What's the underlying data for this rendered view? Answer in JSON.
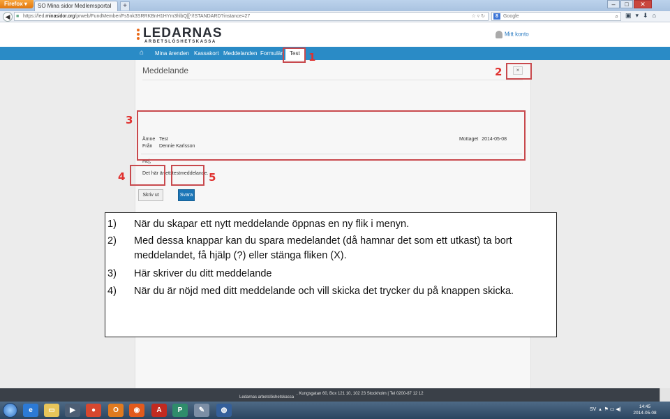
{
  "browser": {
    "firefox_label": "Firefox",
    "tab_title": "SO Mina sidor Medlemsportal",
    "new_tab": "+",
    "url_prefix": "https://led.",
    "url_domain": "minasidor.org",
    "url_path": "/prweb/FundMember/Fs5nk3SRRKBnH1HYm3hlbQ[[*/!STANDARD?instance=27",
    "search_placeholder": "Google",
    "search_engine_icon": "google-icon",
    "window_controls": [
      "–",
      "□",
      "✕"
    ]
  },
  "site": {
    "logo_main": "LEDARNAS",
    "logo_sub": "ARBETSLÖSHETSKASSA",
    "account_link": "Mitt konto",
    "menu": {
      "home_icon": "home-icon",
      "items": [
        "Mina ärenden",
        "Kassakort",
        "Meddelanden",
        "Formulär",
        "Test"
      ]
    }
  },
  "message_panel": {
    "title": "Meddelande",
    "close_label": "×",
    "subject_label": "Ämne",
    "subject_value": "Test",
    "from_label": "Från",
    "from_value": "Dennie Karlsson",
    "received_label": "Mottaget",
    "received_value": "2014-05-08",
    "body_line1": "Hej,",
    "body_line2": "Det här är ett testmeddelande.",
    "print_button": "Skriv ut",
    "reply_button": "Svara"
  },
  "annotations": {
    "n1": "1",
    "n2": "2",
    "n3": "3",
    "n4": "4",
    "n5": "5",
    "color": "#c8494d"
  },
  "instructions": [
    {
      "num": "1)",
      "text": "När du skapar ett nytt meddelande öppnas en ny flik i menyn."
    },
    {
      "num": "2)",
      "text": "Med dessa knappar kan du spara medelandet (då hamnar det som ett utkast) ta bort"
    },
    {
      "num": "",
      "text": "meddelandet, få hjälp (?) eller stänga fliken (X)."
    },
    {
      "num": "3)",
      "text": "Här skriver du ditt meddelande"
    },
    {
      "num": "4)",
      "text": "När du är nöjd med ditt meddelande och vill skicka det trycker du på knappen skicka."
    }
  ],
  "footer": {
    "org": "Ledarnas arbetslöshetskassa",
    "address": ", Kungsgatan 60, Box 121 10, 102 23 Stockholm | Tel 0200-87 12 12"
  },
  "taskbar": {
    "language": "SV",
    "time": "14:45",
    "date": "2014-05-08"
  },
  "colors": {
    "menu_blue": "#2a8bc6",
    "reply_blue": "#1c76b7",
    "logo_orange": "#e86a1a"
  }
}
